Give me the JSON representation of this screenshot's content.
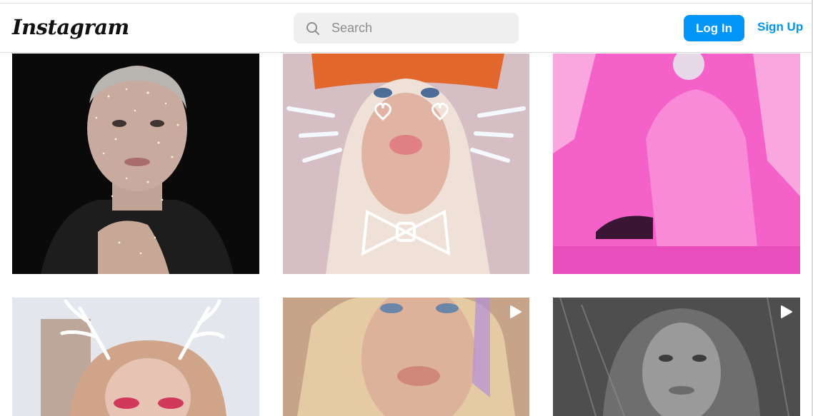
{
  "header": {
    "logo_text": "Instagram",
    "search_placeholder": "Search",
    "login_label": "Log In",
    "signup_label": "Sign Up"
  },
  "colors": {
    "accent": "#0095f6",
    "search_bg": "#efefef",
    "divider": "#dbdbdb"
  },
  "grid": {
    "posts": [
      {
        "kind": "photo",
        "icon": "none"
      },
      {
        "kind": "photo",
        "icon": "none"
      },
      {
        "kind": "photo",
        "icon": "none"
      },
      {
        "kind": "photo",
        "icon": "none"
      },
      {
        "kind": "video",
        "icon": "play-icon"
      },
      {
        "kind": "video",
        "icon": "play-icon"
      }
    ]
  }
}
